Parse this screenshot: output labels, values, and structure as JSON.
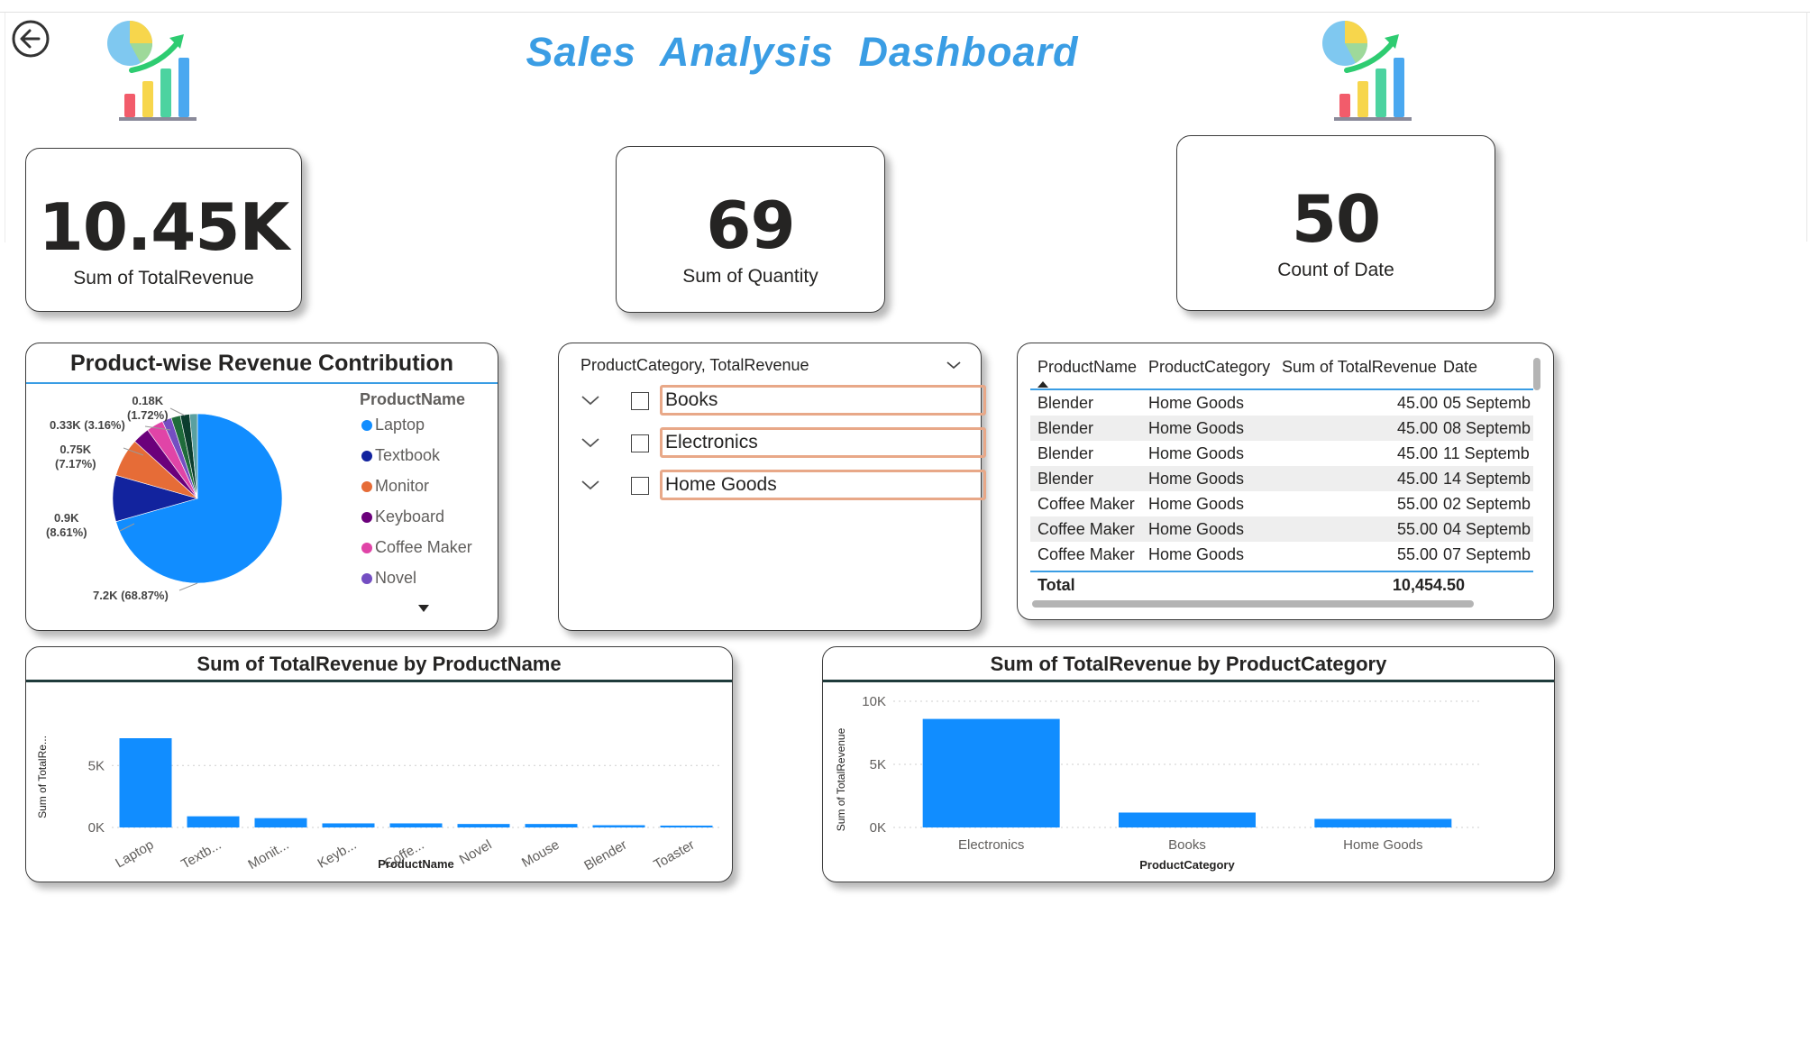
{
  "header": {
    "title": "Sales  Analysis  Dashboard",
    "back_icon": "arrow-left-circle-icon",
    "logo_icon": "chart-growth-icon"
  },
  "colors": {
    "title": "#3a9de4",
    "bar": "#118dff",
    "slicer_border": "#e8a888"
  },
  "kpis": [
    {
      "value": "10.45K",
      "label": "Sum of TotalRevenue"
    },
    {
      "value": "69",
      "label": "Sum of Quantity"
    },
    {
      "value": "50",
      "label": "Count of Date"
    }
  ],
  "pie": {
    "title": "Product-wise Revenue Contribution",
    "legend_title": "ProductName",
    "legend": [
      {
        "label": "Laptop",
        "color": "#118dff"
      },
      {
        "label": "Textbook",
        "color": "#12239e"
      },
      {
        "label": "Monitor",
        "color": "#e66c37"
      },
      {
        "label": "Keyboard",
        "color": "#6b007b"
      },
      {
        "label": "Coffee Maker",
        "color": "#e044a7"
      },
      {
        "label": "Novel",
        "color": "#744ec2"
      }
    ],
    "labels": [
      {
        "line1": "0.18K",
        "line2": "(1.72%)"
      },
      {
        "line1": "0.33K (3.16%)",
        "line2": ""
      },
      {
        "line1": "0.75K",
        "line2": "(7.17%)"
      },
      {
        "line1": "0.9K",
        "line2": "(8.61%)"
      },
      {
        "line1": "7.2K (68.87%)",
        "line2": ""
      }
    ]
  },
  "slicer": {
    "header": "ProductCategory, TotalRevenue",
    "items": [
      {
        "label": "Books"
      },
      {
        "label": "Electronics"
      },
      {
        "label": "Home Goods"
      }
    ]
  },
  "table": {
    "columns": [
      "ProductName",
      "ProductCategory",
      "Sum of TotalRevenue",
      "Date"
    ],
    "rows": [
      [
        "Blender",
        "Home Goods",
        "45.00",
        "05 Septemb"
      ],
      [
        "Blender",
        "Home Goods",
        "45.00",
        "08 Septemb"
      ],
      [
        "Blender",
        "Home Goods",
        "45.00",
        "11 Septemb"
      ],
      [
        "Blender",
        "Home Goods",
        "45.00",
        "14 Septemb"
      ],
      [
        "Coffee Maker",
        "Home Goods",
        "55.00",
        "02 Septemb"
      ],
      [
        "Coffee Maker",
        "Home Goods",
        "55.00",
        "04 Septemb"
      ],
      [
        "Coffee Maker",
        "Home Goods",
        "55.00",
        "07 Septemb"
      ]
    ],
    "total_label": "Total",
    "total_value": "10,454.50"
  },
  "chart_data": [
    {
      "type": "pie",
      "title": "Product-wise Revenue Contribution",
      "legend_title": "ProductName",
      "legend_position": "right",
      "categories": [
        "Laptop",
        "Textbook",
        "Monitor",
        "Keyboard",
        "Coffee Maker",
        "Novel",
        "Mouse",
        "Blender",
        "Toaster"
      ],
      "values": [
        7200,
        900,
        750,
        330,
        330,
        180,
        180,
        180,
        150
      ],
      "colors": [
        "#118dff",
        "#12239e",
        "#e66c37",
        "#6b007b",
        "#e044a7",
        "#744ec2",
        "#1f6b3b",
        "#0b3d2e",
        "#5aa0a0"
      ]
    },
    {
      "type": "bar",
      "title": "Sum of TotalRevenue by ProductName",
      "xlabel": "ProductName",
      "ylabel": "Sum of TotalRe...",
      "categories": [
        "Laptop",
        "Textb...",
        "Monit...",
        "Keyb...",
        "Coffe...",
        "Novel",
        "Mouse",
        "Blender",
        "Toaster"
      ],
      "values": [
        7200,
        900,
        750,
        330,
        330,
        280,
        280,
        180,
        150
      ],
      "yticks": [
        "0K",
        "5K"
      ],
      "ylim": [
        0,
        8000
      ],
      "grid": true
    },
    {
      "type": "bar",
      "title": "Sum of TotalRevenue by ProductCategory",
      "xlabel": "ProductCategory",
      "ylabel": "Sum of TotalRevenue",
      "categories": [
        "Electronics",
        "Books",
        "Home Goods"
      ],
      "values": [
        8600,
        1180,
        680
      ],
      "yticks": [
        "0K",
        "5K",
        "10K"
      ],
      "ylim": [
        0,
        10000
      ],
      "grid": true
    }
  ]
}
